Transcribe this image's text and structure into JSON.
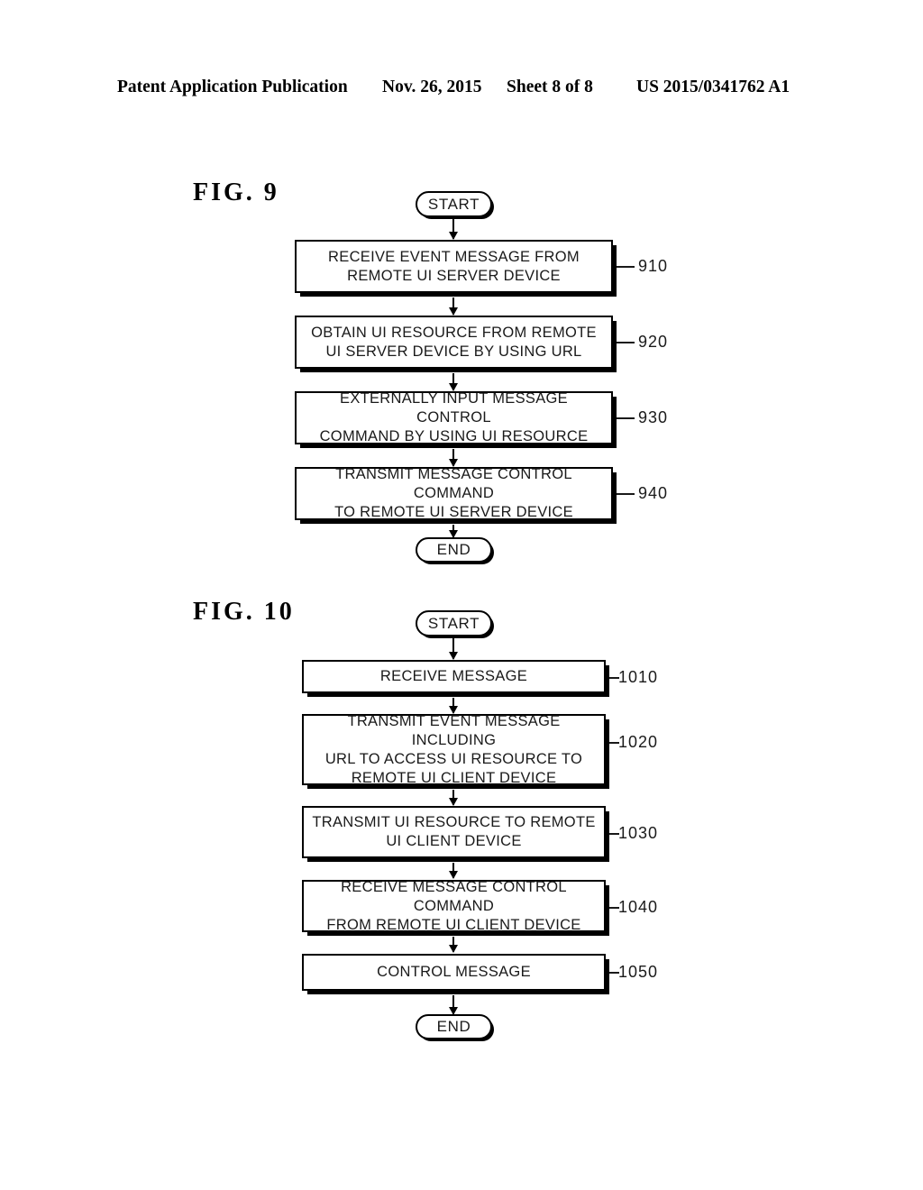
{
  "header": {
    "left": "Patent Application Publication",
    "date": "Nov. 26, 2015",
    "sheet": "Sheet 8 of 8",
    "publication_number": "US 2015/0341762 A1"
  },
  "figures": [
    {
      "title": "FIG.  9",
      "start_label": "START",
      "end_label": "END",
      "steps": [
        {
          "ref": "910",
          "text": "RECEIVE EVENT MESSAGE FROM\nREMOTE UI SERVER DEVICE"
        },
        {
          "ref": "920",
          "text": "OBTAIN UI RESOURCE FROM REMOTE\nUI SERVER DEVICE BY USING URL"
        },
        {
          "ref": "930",
          "text": "EXTERNALLY INPUT MESSAGE CONTROL\nCOMMAND BY USING UI RESOURCE"
        },
        {
          "ref": "940",
          "text": "TRANSMIT MESSAGE CONTROL COMMAND\nTO REMOTE UI SERVER DEVICE"
        }
      ]
    },
    {
      "title": "FIG.  10",
      "start_label": "START",
      "end_label": "END",
      "steps": [
        {
          "ref": "1010",
          "text": "RECEIVE MESSAGE"
        },
        {
          "ref": "1020",
          "text": "TRANSMIT EVENT MESSAGE INCLUDING\nURL TO ACCESS UI RESOURCE TO\nREMOTE UI CLIENT DEVICE"
        },
        {
          "ref": "1030",
          "text": "TRANSMIT UI RESOURCE TO REMOTE\nUI CLIENT DEVICE"
        },
        {
          "ref": "1040",
          "text": "RECEIVE MESSAGE CONTROL COMMAND\nFROM REMOTE UI CLIENT DEVICE"
        },
        {
          "ref": "1050",
          "text": "CONTROL MESSAGE"
        }
      ]
    }
  ]
}
